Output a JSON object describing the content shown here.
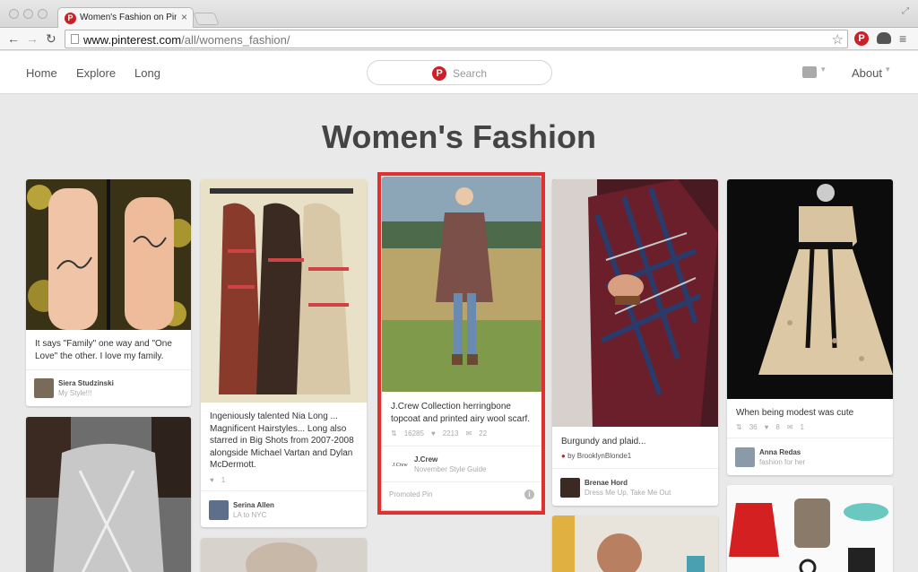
{
  "browser": {
    "tab_title": "Women's Fashion on Pinte",
    "tab_close": "×",
    "url_prefix": "www.",
    "url_host": "pinterest.com",
    "url_path": "/all/womens_fashion/",
    "favicon_letter": "P"
  },
  "header": {
    "nav": [
      "Home",
      "Explore",
      "Long"
    ],
    "search_label": "Search",
    "about_label": "About",
    "accent_color": "#cb2027"
  },
  "page_title": "Women's Fashion",
  "pins": {
    "p1": {
      "description": "It says \"Family\" one way and \"One Love\" the other. I love my family.",
      "user": "Siera Studzinski",
      "board": "My Style!!!"
    },
    "p2": {
      "description": "Ingeniously talented Nia Long ... Magnificent Hairstyles... Long also starred in Big Shots from 2007-2008 alongside Michael Vartan and Dylan McDermott.",
      "likes": "1",
      "user": "Serina Allen",
      "board": "LA to NYC"
    },
    "p3": {
      "description": "J.Crew Collection herringbone topcoat and printed airy wool scarf.",
      "repins": "16285",
      "likes": "2213",
      "comments": "22",
      "user": "J.Crew",
      "board": "November Style Guide",
      "promoted": "Promoted Pin",
      "logo_text": "J.Crew"
    },
    "p4": {
      "description": "Burgundy and plaid...",
      "via": "by BrooklynBlonde1",
      "user": "Brenae Hord",
      "board": "Dress Me Up, Take Me Out"
    },
    "p5": {
      "description": "When being modest was cute",
      "repins": "36",
      "likes": "8",
      "comments": "1",
      "user": "Anna Redas",
      "board": "fashion for her"
    }
  },
  "icons": {
    "back": "back-arrow-icon",
    "forward": "forward-arrow-icon",
    "reload": "reload-icon",
    "star": "bookmark-star-icon",
    "menu": "menu-icon",
    "info": "info-icon"
  }
}
